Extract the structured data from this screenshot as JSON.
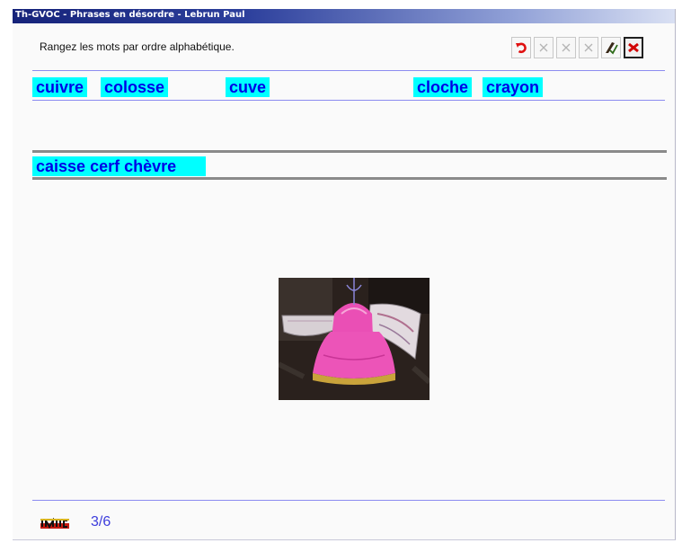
{
  "window": {
    "title": "Th-GVOC - Phrases en désordre - Lebrun Paul"
  },
  "instruction": "Rangez les mots par ordre alphabétique.",
  "toolbar": {
    "buttons": [
      {
        "icon": "undo-icon",
        "state": "enabled"
      },
      {
        "icon": "x-icon",
        "state": "disabled"
      },
      {
        "icon": "x-icon",
        "state": "disabled"
      },
      {
        "icon": "x-icon",
        "state": "disabled"
      },
      {
        "icon": "pencil-check-icon",
        "state": "enabled"
      },
      {
        "icon": "exit-icon",
        "state": "pressed"
      }
    ]
  },
  "source_words": [
    "cuivre",
    "colosse",
    "cuve",
    "cloche",
    "crayon"
  ],
  "answer_words": [
    "caisse",
    "cerf",
    "chèvre"
  ],
  "image": {
    "subject": "papier-mâché pink bell with wings"
  },
  "footer": {
    "logo_text": "JMC",
    "progress": "3/6"
  },
  "colors": {
    "word_highlight": "#00ffff",
    "word_text": "#0000e6",
    "accent_line": "#8c8cf0"
  }
}
